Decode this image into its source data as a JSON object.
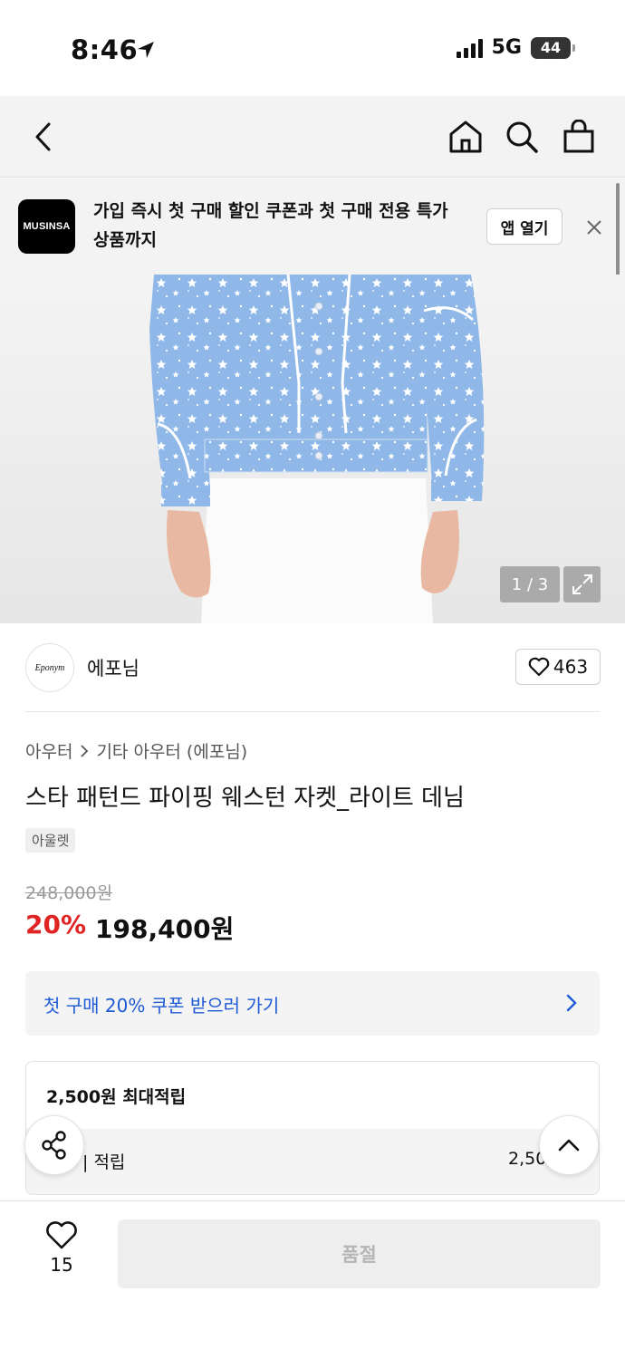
{
  "status_bar": {
    "time": "8:46",
    "network": "5G",
    "battery": "44"
  },
  "app_banner": {
    "logo_text": "MUSINSA",
    "promo": "가입 즉시 첫 구매 할인 쿠폰과 첫 구매 전용 특가 상품까지",
    "open_label": "앱 열기"
  },
  "gallery": {
    "counter": "1 / 3"
  },
  "brand": {
    "logo_text": "Eponym",
    "name": "에포님",
    "like_count": "463"
  },
  "breadcrumb": [
    "아우터",
    "기타 아우터 (에포님)"
  ],
  "product": {
    "title": "스타 패턴드 파이핑 웨스턴 자켓_라이트 데님",
    "tag": "아울렛",
    "original_price": "248,000원",
    "discount": "20%",
    "price": "198,400원"
  },
  "coupon": {
    "label": "첫 구매 20% 쿠폰 받으러 가기"
  },
  "points": {
    "title": "2,500원 최대적립",
    "row_label": "| 적립",
    "row_value": "2,50"
  },
  "bottom_bar": {
    "wish_count": "15",
    "buy_label": "품절"
  },
  "colors": {
    "accent_red": "#e02424",
    "link_blue": "#1f5ad6",
    "denim": "#8fb8e8"
  }
}
